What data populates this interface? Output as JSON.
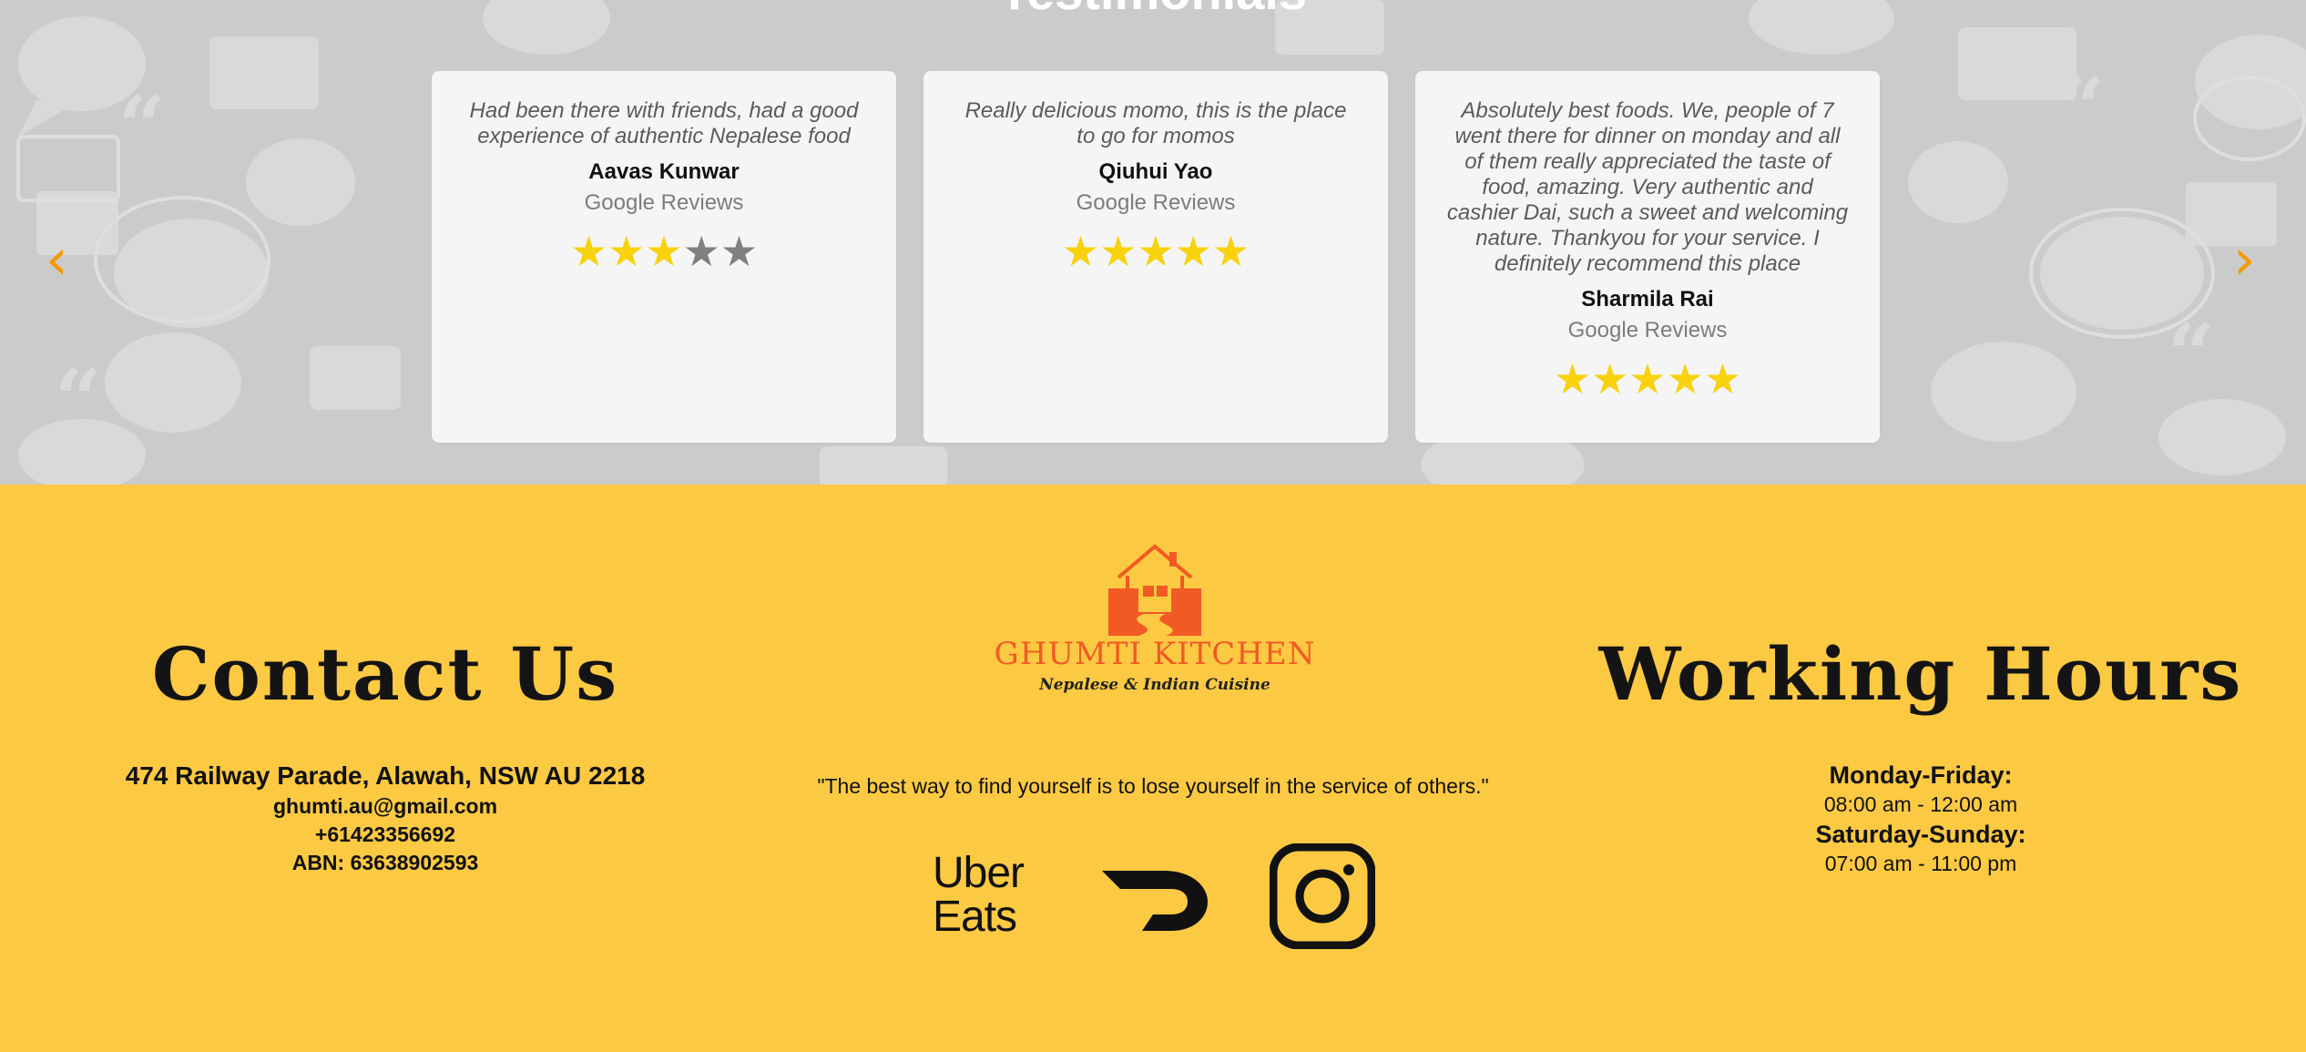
{
  "testimonials": {
    "heading": "Testimonials",
    "prev_icon": "chevron-left-icon",
    "next_icon": "chevron-right-icon",
    "prev_label": "‹",
    "next_label": "›",
    "reviews": [
      {
        "text": "Had been there with friends, had a good experience of authentic Nepalese food",
        "name": "Aavas Kunwar",
        "source": "Google Reviews",
        "rating": 3,
        "max_rating": 5
      },
      {
        "text": "Really delicious momo, this is the place to go for momos",
        "name": "Qiuhui Yao",
        "source": "Google Reviews",
        "rating": 5,
        "max_rating": 5
      },
      {
        "text": "Absolutely best foods. We, people of 7 went there for dinner on monday and all of them really appreciated the taste of food, amazing. Very authentic and cashier Dai, such a sweet and welcoming nature. Thankyou for your service. I definitely recommend this place",
        "name": "Sharmila Rai",
        "source": "Google Reviews",
        "rating": 5,
        "max_rating": 5
      }
    ]
  },
  "contact": {
    "heading": "Contact Us",
    "address": "474 Railway Parade, Alawah, NSW AU 2218",
    "email": "ghumti.au@gmail.com",
    "phone": "+61423356692",
    "abn": "ABN: 63638902593"
  },
  "brand": {
    "name": "GHUMTI KITCHEN",
    "tagline": "Nepalese & Indian Cuisine",
    "logo_icon": "house-logo-icon",
    "quote": "\"The best way to find yourself is to lose yourself in the service of others.\""
  },
  "social": {
    "ubereats_line1": "Uber",
    "ubereats_line2": "Eats",
    "ubereats_icon": "uber-eats-icon",
    "doordash_icon": "doordash-icon",
    "instagram_icon": "instagram-icon"
  },
  "hours": {
    "heading": "Working Hours",
    "weekday_label": "Monday-Friday:",
    "weekday_time": "08:00 am - 12:00 am",
    "weekend_label": "Saturday-Sunday:",
    "weekend_time": "07:00 am - 11:00 pm"
  },
  "colors": {
    "footer_bg": "#fcc943",
    "accent_orange": "#f15a24",
    "arrow": "#f29b05",
    "star_filled": "#f7d20d",
    "star_empty": "#808080"
  }
}
